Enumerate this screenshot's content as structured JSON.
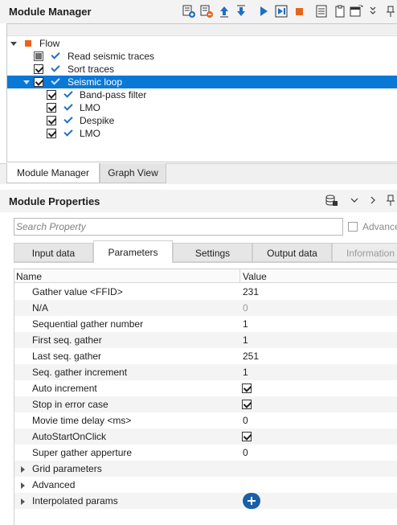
{
  "module_manager": {
    "title": "Module Manager",
    "toolbar_icons": [
      "add-module-icon",
      "remove-module-icon",
      "move-up-icon",
      "move-down-icon",
      "run-icon",
      "step-run-icon",
      "stop-icon",
      "log-icon",
      "clipboard-icon",
      "window-menu-icon",
      "more-icon",
      "pin-icon"
    ],
    "tree": [
      {
        "label": "Flow",
        "level": 0,
        "checkbox": "none",
        "expanded": true,
        "node_icon": "flow-icon"
      },
      {
        "label": "Read seismic traces",
        "level": 1,
        "checkbox": "indeterminate",
        "tick": true
      },
      {
        "label": "Sort traces",
        "level": 1,
        "checkbox": "checked",
        "tick": true
      },
      {
        "label": "Seismic loop",
        "level": 1,
        "checkbox": "checked",
        "tick": true,
        "selected": true,
        "expanded": true
      },
      {
        "label": "Band-pass filter",
        "level": 2,
        "checkbox": "checked",
        "tick": true
      },
      {
        "label": "LMO",
        "level": 2,
        "checkbox": "checked",
        "tick": true
      },
      {
        "label": "Despike",
        "level": 2,
        "checkbox": "checked",
        "tick": true
      },
      {
        "label": "LMO",
        "level": 2,
        "checkbox": "checked",
        "tick": true
      }
    ],
    "tabs": [
      {
        "label": "Module Manager",
        "active": true
      },
      {
        "label": "Graph View",
        "active": false
      }
    ]
  },
  "module_properties": {
    "title": "Module Properties",
    "search_placeholder": "Search Property",
    "advanced_label": "Advanced",
    "tabs": [
      {
        "label": "Input data",
        "active": false
      },
      {
        "label": "Parameters",
        "active": true
      },
      {
        "label": "Settings",
        "active": false
      },
      {
        "label": "Output data",
        "active": false
      },
      {
        "label": "Information",
        "active": false,
        "disabled": true
      }
    ],
    "grid_headers": {
      "name": "Name",
      "value": "Value"
    },
    "rows": [
      {
        "name": "Gather value <FFID>",
        "value": "231",
        "type": "text"
      },
      {
        "name": "N/A",
        "value": "0",
        "type": "text",
        "disabled": true
      },
      {
        "name": "Sequential gather number",
        "value": "1",
        "type": "text"
      },
      {
        "name": "First seq. gather",
        "value": "1",
        "type": "text"
      },
      {
        "name": "Last seq. gather",
        "value": "251",
        "type": "text"
      },
      {
        "name": "Seq. gather increment",
        "value": "1",
        "type": "text"
      },
      {
        "name": "Auto increment",
        "value": true,
        "type": "checkbox"
      },
      {
        "name": "Stop in error case",
        "value": true,
        "type": "checkbox"
      },
      {
        "name": "Movie time delay <ms>",
        "value": "0",
        "type": "text"
      },
      {
        "name": "AutoStartOnClick",
        "value": true,
        "type": "checkbox"
      },
      {
        "name": "Super gather apperture",
        "value": "0",
        "type": "text"
      },
      {
        "name": "Grid parameters",
        "type": "group"
      },
      {
        "name": "Advanced",
        "type": "group"
      },
      {
        "name": "Interpolated params",
        "type": "add"
      }
    ]
  },
  "colors": {
    "selection": "#0a78d7",
    "accent_blue": "#1f6fc4",
    "stop_orange": "#e8641b"
  }
}
